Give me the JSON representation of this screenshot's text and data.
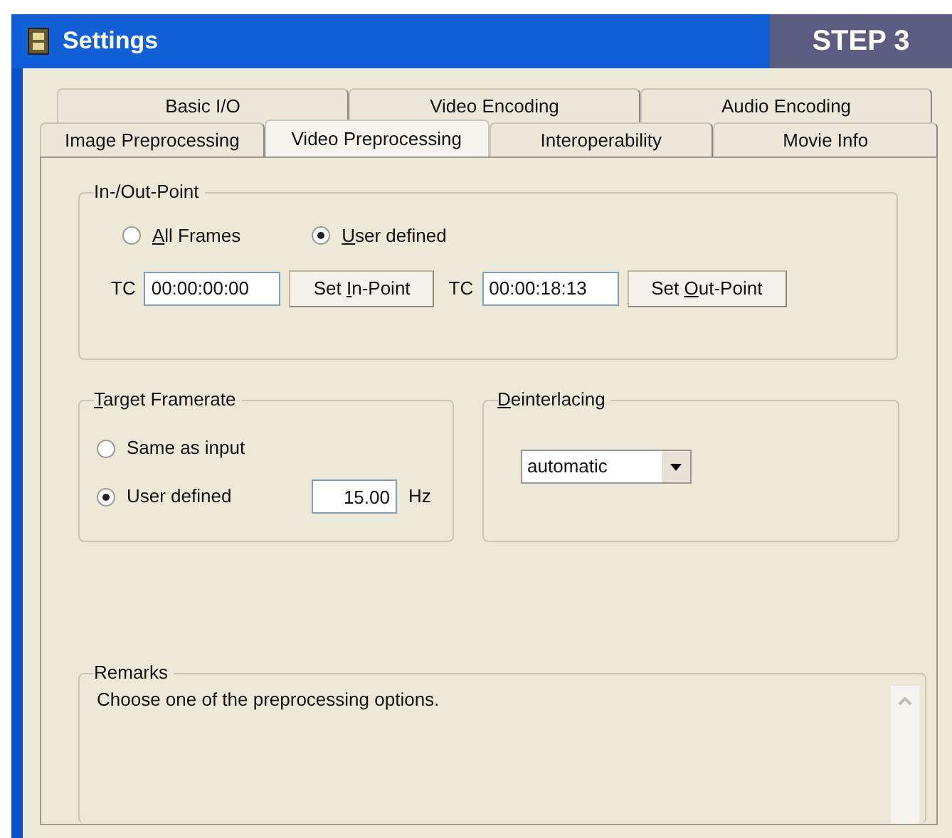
{
  "window": {
    "title": "Settings"
  },
  "badge": "STEP 3",
  "tab_rows": [
    [
      {
        "label": "Basic I/O",
        "selected": false
      },
      {
        "label": "Video Encoding",
        "selected": false
      },
      {
        "label": "Audio Encoding",
        "selected": false
      }
    ],
    [
      {
        "label": "Image Preprocessing",
        "selected": false
      },
      {
        "label": "Video Preprocessing",
        "selected": true
      },
      {
        "label": "Interoperability",
        "selected": false
      },
      {
        "label": "Movie Info",
        "selected": false
      }
    ]
  ],
  "in_out_point": {
    "title": "In-/Out-Point",
    "options": [
      {
        "access_key": "A",
        "label_rest": "ll Frames",
        "selected": false
      },
      {
        "access_key": "U",
        "label_rest": "ser defined",
        "selected": true
      }
    ],
    "in_label": "TC",
    "in_value": "00:00:00:00",
    "in_button": {
      "label_start": "Set ",
      "access_key": "I",
      "label_rest": "n-Point"
    },
    "out_label": "TC",
    "out_value": "00:00:18:13",
    "out_button": {
      "label_start": "Set ",
      "access_key": "O",
      "label_rest": "ut-Point"
    }
  },
  "target_framerate": {
    "access_key": "T",
    "title_rest": "arget Framerate",
    "options": [
      {
        "label": "Same as input",
        "selected": false
      },
      {
        "label": "User defined",
        "selected": true
      }
    ],
    "value": "15.00",
    "unit": "Hz"
  },
  "deinterlacing": {
    "access_key": "D",
    "title_rest": "einterlacing",
    "value": "automatic"
  },
  "remarks": {
    "title": "Remarks",
    "text": "Choose one of the preprocessing options."
  }
}
